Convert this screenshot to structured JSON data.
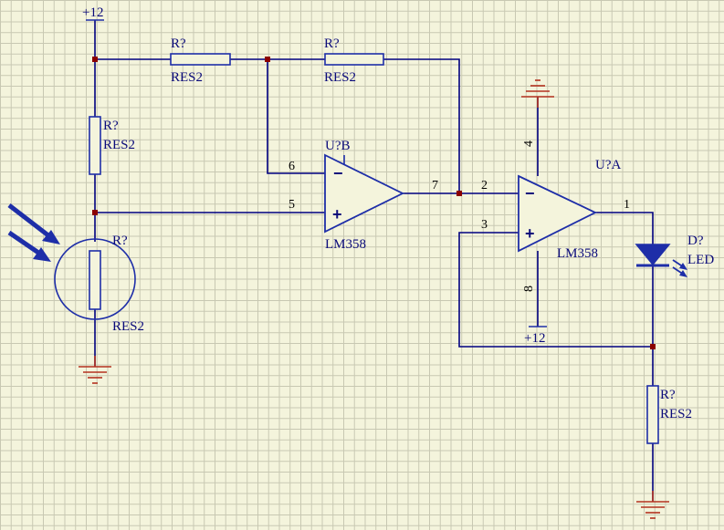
{
  "power": {
    "vcc_top": "+12",
    "vcc_bottom": "+12"
  },
  "resistors": {
    "r_top_left": {
      "designator": "R?",
      "type": "RES2"
    },
    "r_top_right": {
      "designator": "R?",
      "type": "RES2"
    },
    "r_left_vertical": {
      "designator": "R?",
      "type": "RES2"
    },
    "r_photo": {
      "designator": "R?",
      "type": "RES2"
    },
    "r_led": {
      "designator": "R?",
      "type": "RES2"
    }
  },
  "opamps": {
    "u_b": {
      "designator": "U?B",
      "part": "LM358",
      "minus_sign": "−",
      "plus_sign": "+"
    },
    "u_a": {
      "designator": "U?A",
      "part": "LM358",
      "minus_sign": "−",
      "plus_sign": "+"
    }
  },
  "pins": {
    "p6": "6",
    "p5": "5",
    "p7": "7",
    "p2": "2",
    "p3": "3",
    "p1": "1",
    "p4": "4",
    "p8": "8"
  },
  "diode": {
    "designator": "D?",
    "type": "LED"
  },
  "colors": {
    "wire": "#000080",
    "part": "#1e2ea8",
    "ground": "#b3311f",
    "junction": "#8b0000",
    "grid": "#c8c8b2",
    "background": "#f4f4dc"
  },
  "icons": [
    "ground-symbol-icon",
    "light-arrow-icon",
    "led-icon",
    "resistor-icon",
    "op-amp-icon"
  ]
}
